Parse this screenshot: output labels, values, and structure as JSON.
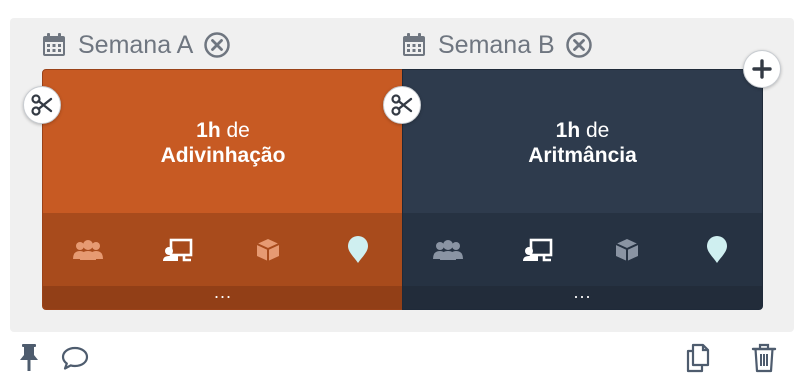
{
  "weeks": [
    {
      "label": "Semana A",
      "hours": "1h",
      "connector": "de",
      "subject": "Adivinhação",
      "more": "...",
      "color": "#c75a23"
    },
    {
      "label": "Semana B",
      "hours": "1h",
      "connector": "de",
      "subject": "Aritmância",
      "more": "...",
      "color": "#2e3b4d"
    }
  ],
  "icons": {
    "week_header": "calendar-icon",
    "remove": "close-circle-icon",
    "split": "scissors-icon",
    "add": "plus-icon",
    "card_row": [
      "group-icon",
      "teacher-board-icon",
      "box-icon",
      "location-pin-icon"
    ],
    "footer_left": [
      "pin-icon",
      "comment-icon"
    ],
    "footer_right": [
      "duplicate-icon",
      "trash-icon"
    ]
  },
  "colors": {
    "panel_bg": "#f0f0f0",
    "header_text": "#6f7680",
    "pin_fill": "#cfeff0"
  }
}
